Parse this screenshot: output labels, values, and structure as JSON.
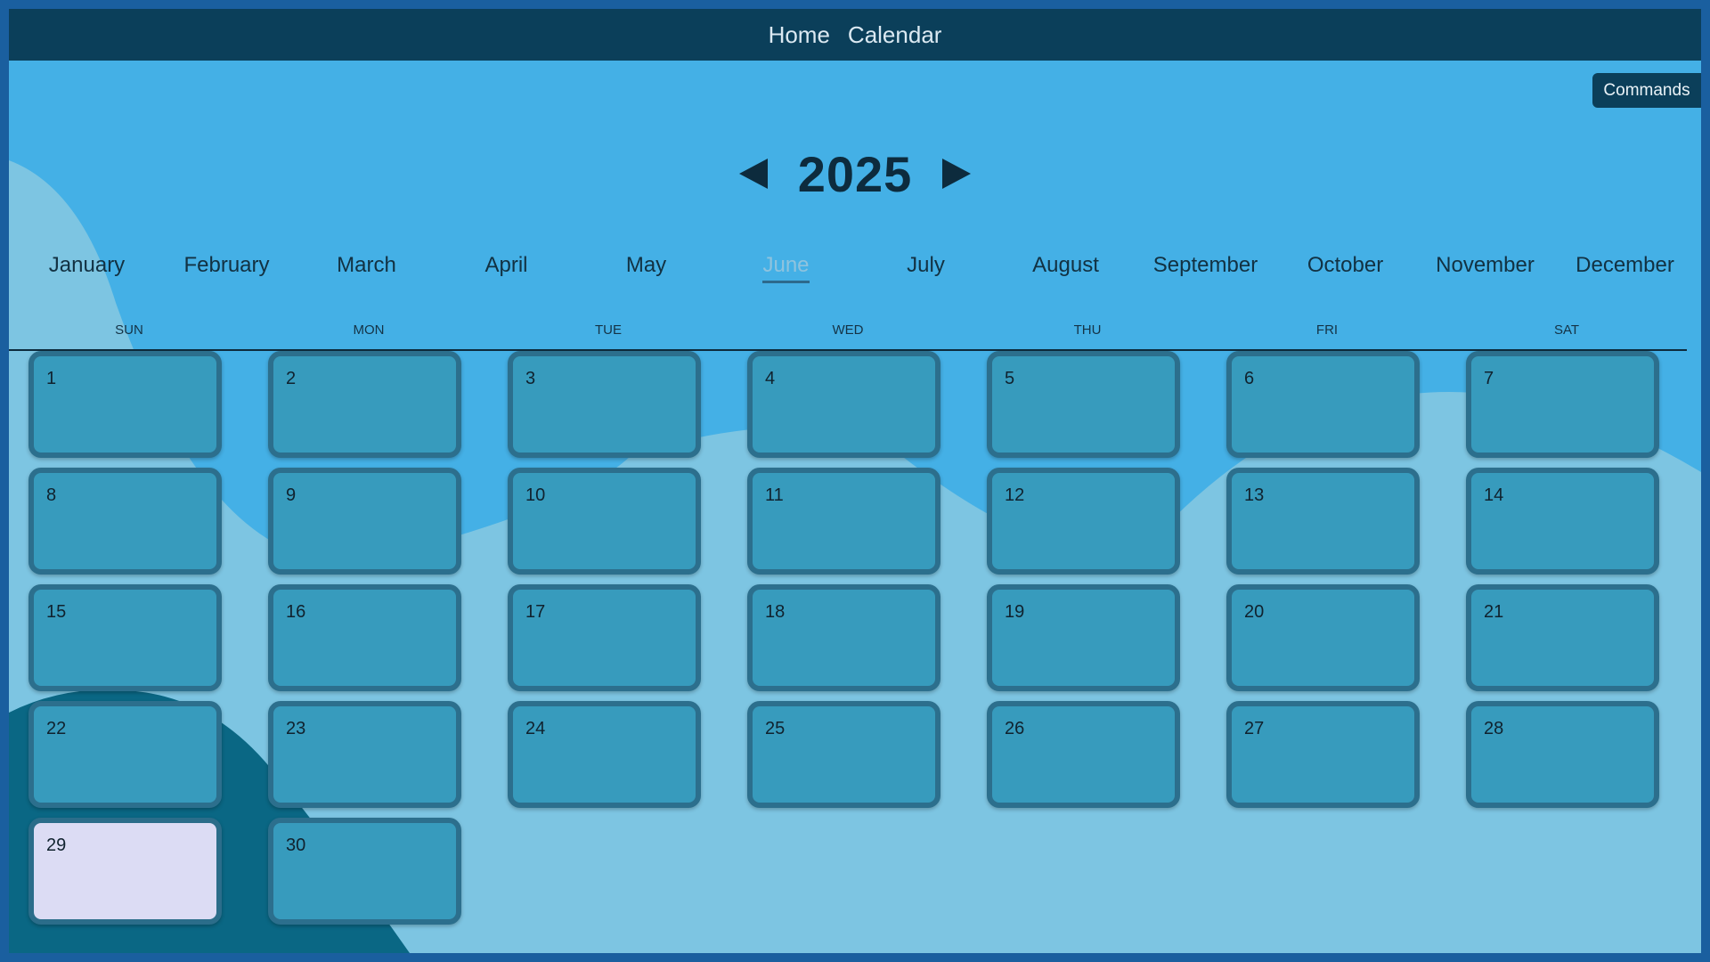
{
  "nav": {
    "home_label": "Home",
    "calendar_label": "Calendar"
  },
  "commands_label": "Commands",
  "year": "2025",
  "selected_month": "June",
  "months": [
    "January",
    "February",
    "March",
    "April",
    "May",
    "June",
    "July",
    "August",
    "September",
    "October",
    "November",
    "December"
  ],
  "weekdays": [
    "SUN",
    "MON",
    "TUE",
    "WED",
    "THU",
    "FRI",
    "SAT"
  ],
  "days": [
    "1",
    "2",
    "3",
    "4",
    "5",
    "6",
    "7",
    "8",
    "9",
    "10",
    "11",
    "12",
    "13",
    "14",
    "15",
    "16",
    "17",
    "18",
    "19",
    "20",
    "21",
    "22",
    "23",
    "24",
    "25",
    "26",
    "27",
    "28",
    "29",
    "30"
  ],
  "highlighted_day": "29",
  "icons": {
    "prev": "left-triangle-icon",
    "next": "right-triangle-icon"
  },
  "colors": {
    "topbar": "#0b3f5a",
    "background": "#44b0e6",
    "day_tile": "#379bbd",
    "today_tile": "#dcdcf4"
  }
}
